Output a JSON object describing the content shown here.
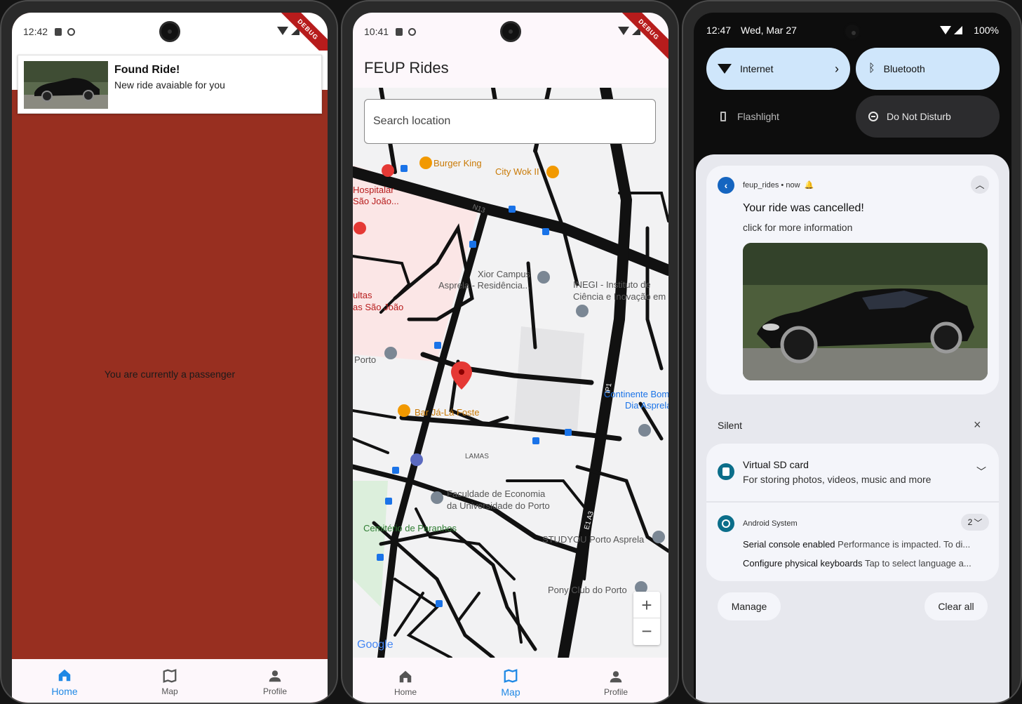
{
  "phone1": {
    "status_time": "12:42",
    "debug_label": "DEBUG",
    "notification": {
      "title": "Found Ride!",
      "body": "New ride avaiable for you"
    },
    "passenger_text": "You are currently a passenger",
    "background_color": "#982f20",
    "nav": {
      "home": "Home",
      "map": "Map",
      "profile": "Profile",
      "active": "home"
    }
  },
  "phone2": {
    "status_time": "10:41",
    "debug_label": "DEBUG",
    "app_title": "FEUP Rides",
    "search_placeholder": "Search location",
    "map_labels": [
      "Burger King",
      "City Wok II",
      "Hospitalar São João...",
      "Xior Campus Asprela - Residência...",
      "INEGI - Instituto de Ciência e Inovação em",
      "ultas as São João",
      "Porto",
      "Continente Bom Dia Asprela",
      "Bar Já-Lá Foste",
      "LAMAS",
      "Faculdade de Economia da Universidade do Porto",
      "Cemitério de Paranhos",
      "STUDYOU Porto Asprela",
      "Pony Club do Porto",
      "Google",
      "N13",
      "IP1",
      "E1 A3"
    ],
    "nav": {
      "home": "Home",
      "map": "Map",
      "profile": "Profile",
      "active": "map"
    }
  },
  "phone3": {
    "status_time": "12:47",
    "status_date": "Wed, Mar 27",
    "battery": "100%",
    "tiles": {
      "internet": "Internet",
      "bluetooth": "Bluetooth",
      "flashlight": "Flashlight",
      "dnd": "Do Not Disturb"
    },
    "notif1": {
      "app": "feup_rides",
      "time": "now",
      "title": "Your ride was cancelled!",
      "body": "click for more information"
    },
    "silent_label": "Silent",
    "notif2": {
      "title": "Virtual SD card",
      "body": "For storing photos, videos, music and more"
    },
    "notif3": {
      "app": "Android System",
      "count": "2",
      "line1_bold": "Serial console enabled",
      "line1": "Performance is impacted. To di...",
      "line2_bold": "Configure physical keyboards",
      "line2": "Tap to select language a..."
    },
    "manage": "Manage",
    "clear_all": "Clear all"
  }
}
